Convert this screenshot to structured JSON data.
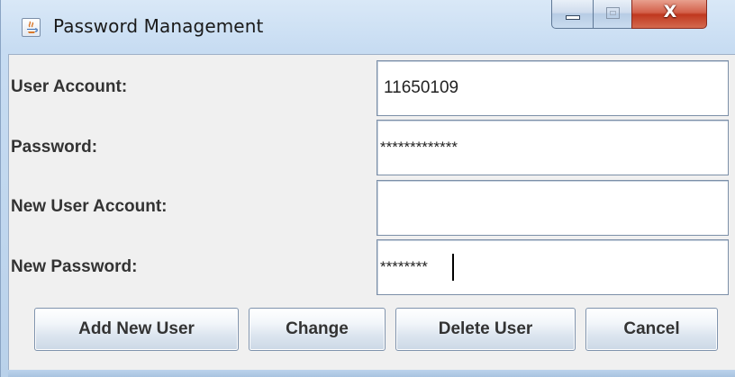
{
  "window": {
    "title": "Password Management",
    "icon": "java-cup-icon",
    "controls": {
      "minimize": "minimize-icon",
      "maximize": "maximize-icon",
      "close_glyph": "X"
    }
  },
  "form": {
    "user_account": {
      "label": "User Account:",
      "value": "11650109"
    },
    "password": {
      "label": "Password:",
      "value": "*************"
    },
    "new_user_account": {
      "label": "New User Account:",
      "value": ""
    },
    "new_password": {
      "label": "New Password:",
      "value": "********"
    }
  },
  "buttons": {
    "add_new_user": "Add New User",
    "change": "Change",
    "delete_user": "Delete User",
    "cancel": "Cancel"
  },
  "colors": {
    "close_button": "#c0381f",
    "client_background": "#f0f0f0",
    "label_text": "#333333"
  }
}
